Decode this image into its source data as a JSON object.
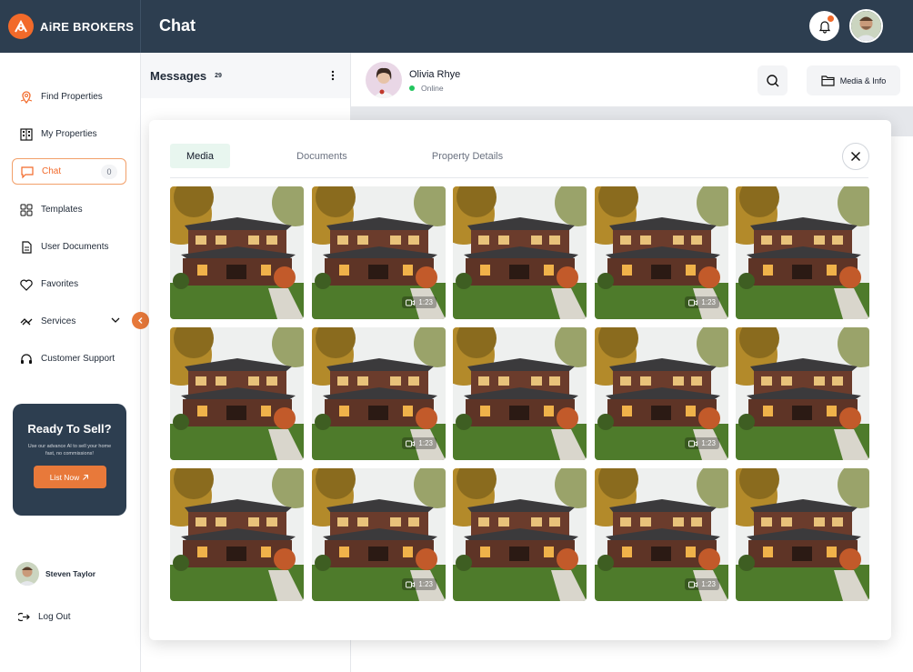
{
  "brand": {
    "name": "AiRE BROKERS"
  },
  "header": {
    "title": "Chat"
  },
  "sidebar": {
    "items": [
      {
        "label": "Find Properties",
        "icon": "map-pin-icon"
      },
      {
        "label": "My Properties",
        "icon": "building-icon"
      },
      {
        "label": "Chat",
        "icon": "chat-icon",
        "count": "0",
        "active": true
      },
      {
        "label": "Templates",
        "icon": "templates-icon"
      },
      {
        "label": "User Documents",
        "icon": "document-icon"
      },
      {
        "label": "Favorites",
        "icon": "heart-icon"
      },
      {
        "label": "Services",
        "icon": "services-icon"
      },
      {
        "label": "Customer Support",
        "icon": "headset-icon"
      }
    ],
    "sell_card": {
      "title": "Ready To Sell?",
      "text": "Use our advance AI to sell your home fast, no commissions!",
      "button": "List Now"
    },
    "user": {
      "name": "Steven Taylor"
    },
    "logout": "Log Out"
  },
  "messages": {
    "title": "Messages",
    "count": "29"
  },
  "chat": {
    "contact_name": "Olivia Rhye",
    "status": "Online",
    "media_button": "Media & Info"
  },
  "modal": {
    "tabs": [
      {
        "label": "Media",
        "active": true
      },
      {
        "label": "Documents",
        "active": false
      },
      {
        "label": "Property Details",
        "active": false
      }
    ],
    "media": [
      {
        "video": false
      },
      {
        "video": true,
        "duration": "1:23"
      },
      {
        "video": false
      },
      {
        "video": true,
        "duration": "1:23"
      },
      {
        "video": false
      },
      {
        "video": false
      },
      {
        "video": true,
        "duration": "1:23"
      },
      {
        "video": false
      },
      {
        "video": true,
        "duration": "1:23"
      },
      {
        "video": false
      },
      {
        "video": false
      },
      {
        "video": true,
        "duration": "1:23"
      },
      {
        "video": false
      },
      {
        "video": true,
        "duration": "1:23"
      },
      {
        "video": false
      }
    ]
  },
  "colors": {
    "accent": "#f26a2a",
    "navy": "#2d3e50",
    "online": "#22c55e"
  }
}
